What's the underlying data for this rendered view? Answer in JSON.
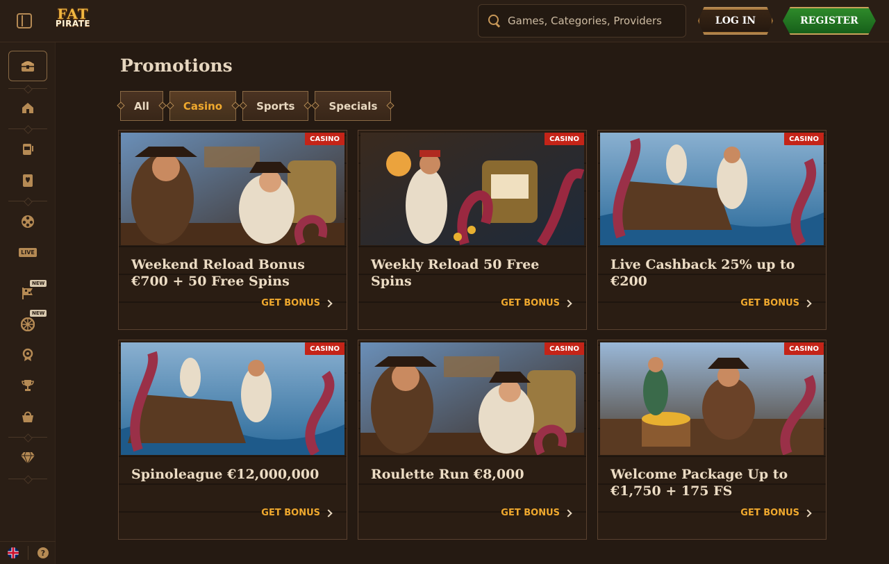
{
  "header": {
    "logo_top": "FAT",
    "logo_bottom": "PIRATE",
    "search_placeholder": "Games, Categories, Providers",
    "login_label": "LOG IN",
    "register_label": "REGISTER"
  },
  "sidebar": {
    "items": [
      {
        "icon": "treasure-chest-icon"
      },
      {
        "icon": "home-icon"
      },
      {
        "icon": "slot-machine-icon"
      },
      {
        "icon": "card-icon"
      },
      {
        "icon": "film-reel-icon"
      },
      {
        "icon": "live-icon",
        "label": "LIVE"
      },
      {
        "icon": "race-flag-icon",
        "badge": "NEW"
      },
      {
        "icon": "wheel-icon",
        "badge": "NEW"
      },
      {
        "icon": "medal-icon"
      },
      {
        "icon": "trophy-icon"
      },
      {
        "icon": "shop-basket-icon"
      },
      {
        "icon": "diamond-icon"
      }
    ],
    "help_label": "?"
  },
  "main": {
    "title": "Promotions",
    "filters": [
      {
        "label": "All",
        "active": false
      },
      {
        "label": "Casino",
        "active": true
      },
      {
        "label": "Sports",
        "active": false
      },
      {
        "label": "Specials",
        "active": false
      }
    ],
    "cards": [
      {
        "tag": "CASINO",
        "title": "Weekend Reload Bonus €700 + 50 Free Spins",
        "cta": "GET BONUS",
        "scene": "tavern"
      },
      {
        "tag": "CASINO",
        "title": "Weekly Reload 50 Free Spins",
        "cta": "GET BONUS",
        "scene": "slot"
      },
      {
        "tag": "CASINO",
        "title": "Live Cashback 25% up to €200",
        "cta": "GET BONUS",
        "scene": "kraken"
      },
      {
        "tag": "CASINO",
        "title": "Spinoleague €12,000,000",
        "cta": "GET BONUS",
        "scene": "kraken"
      },
      {
        "tag": "CASINO",
        "title": "Roulette Run €8,000",
        "cta": "GET BONUS",
        "scene": "tavern"
      },
      {
        "tag": "CASINO",
        "title": "Welcome Package Up to €1,750 + 175 FS",
        "cta": "GET BONUS",
        "scene": "treasure"
      }
    ]
  },
  "colors": {
    "accent": "#f0a92e",
    "tag_red": "#c42418",
    "register_green": "#2e8a2a",
    "background": "#251a12"
  }
}
